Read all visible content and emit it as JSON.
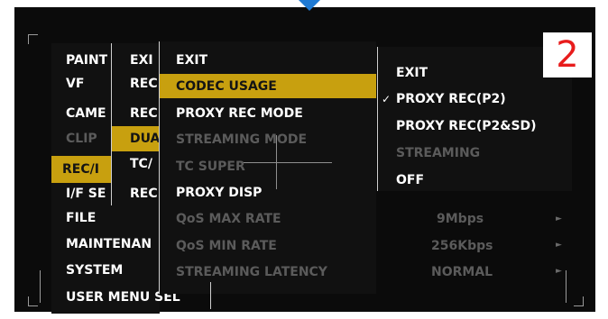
{
  "badge_number": "2",
  "accent_color": "#c8a00f",
  "main_menu": [
    {
      "label": "PAINT",
      "state": "normal"
    },
    {
      "label": "VF",
      "state": "normal"
    },
    {
      "label": "CAME",
      "state": "normal"
    },
    {
      "label": "CLIP",
      "state": "disabled"
    },
    {
      "label": "REC/I",
      "state": "selected"
    },
    {
      "label": "I/F SE",
      "state": "normal"
    },
    {
      "label": "FILE",
      "state": "normal"
    },
    {
      "label": "MAINTENAN",
      "state": "normal"
    },
    {
      "label": "SYSTEM",
      "state": "normal"
    },
    {
      "label": "USER MENU SEL",
      "state": "normal"
    }
  ],
  "sub_menu": [
    {
      "label": "EXI",
      "state": "normal"
    },
    {
      "label": "REC",
      "state": "normal"
    },
    {
      "label": "REC",
      "state": "normal"
    },
    {
      "label": "DUA",
      "state": "selected"
    },
    {
      "label": "TC/",
      "state": "normal"
    },
    {
      "label": "REC",
      "state": "normal"
    }
  ],
  "proxy_menu": [
    {
      "label": "EXIT",
      "state": "normal"
    },
    {
      "label": "CODEC USAGE",
      "state": "selected"
    },
    {
      "label": "PROXY REC MODE",
      "state": "normal"
    },
    {
      "label": "STREAMING MODE",
      "state": "disabled"
    },
    {
      "label": "TC SUPER",
      "state": "disabled"
    },
    {
      "label": "PROXY DISP",
      "state": "normal"
    },
    {
      "label": "QoS MAX RATE",
      "state": "disabled",
      "value": "9Mbps"
    },
    {
      "label": "QoS MIN RATE",
      "state": "disabled",
      "value": "256Kbps"
    },
    {
      "label": "STREAMING LATENCY",
      "state": "disabled",
      "value": "NORMAL"
    }
  ],
  "options_menu": [
    {
      "label": "EXIT",
      "state": "normal",
      "checked": false
    },
    {
      "label": "PROXY REC(P2)",
      "state": "normal",
      "checked": true
    },
    {
      "label": "PROXY REC(P2&SD)",
      "state": "normal",
      "checked": false
    },
    {
      "label": "STREAMING",
      "state": "disabled",
      "checked": false
    },
    {
      "label": "OFF",
      "state": "normal",
      "checked": false
    }
  ],
  "check_mark": "✓",
  "arrow_glyph": "►"
}
